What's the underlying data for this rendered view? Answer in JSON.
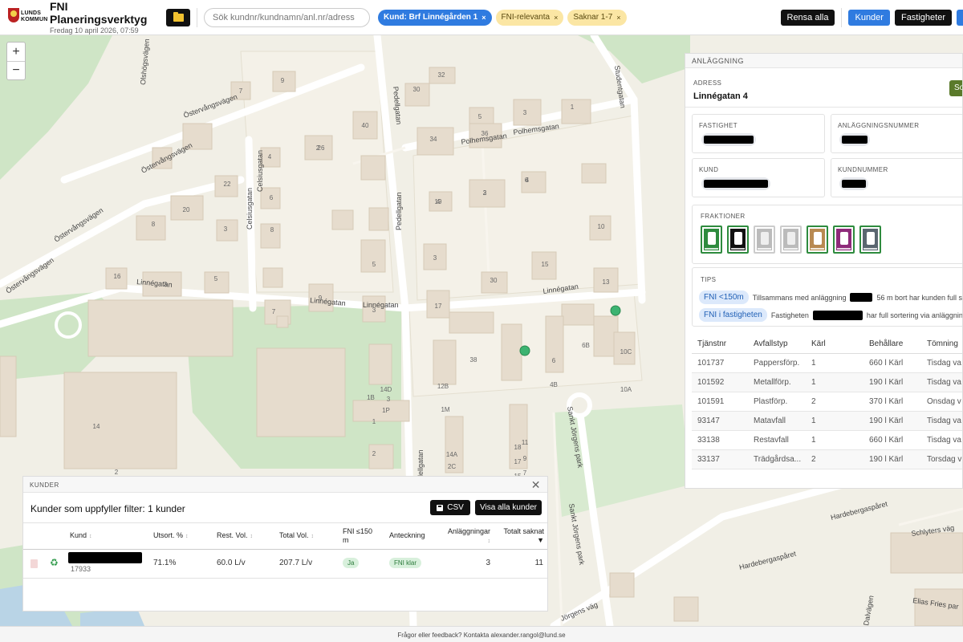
{
  "header": {
    "logo_text": "LUNDS KOMMUN",
    "title": "FNI Planeringsverktyg",
    "date": "Fredag 10 april 2026, 07:59",
    "folder_icon": "folder-icon",
    "search_placeholder": "Sök kundnr/kundnamn/anl.nr/adress",
    "filters": [
      {
        "label": "Kund: Brf Linnégården 1",
        "style": "blue"
      },
      {
        "label": "FNI-relevanta",
        "style": "yellow"
      },
      {
        "label": "Saknar 1-7",
        "style": "yellow"
      }
    ],
    "remove_glyph": "×",
    "clear_all": "Rensa alla",
    "view_customers": "Kunder",
    "view_properties": "Fastigheter"
  },
  "map": {
    "zoom_in": "+",
    "zoom_out": "−",
    "street_labels": [
      "Östervångsvägen",
      "Östervångsvägen",
      "Östervångsvägen",
      "Östervångsvägen",
      "Olshögsvägen",
      "Celsiusgatan",
      "Celsiusgatan",
      "Pedellgatan",
      "Pedellgatan",
      "Polhemsgatan",
      "Polhemsgatan",
      "Studentgatan",
      "Linnégatan",
      "Linnégatan",
      "Linnégatan",
      "Linnégatan",
      "Sankt Jörgens park",
      "Sankt Jörgens park",
      "Hardebergaspåret",
      "Hardebergaspåret",
      "Schlyters väg",
      "Elias Fries par",
      "Pedellgatan",
      "Jörgens väg",
      "Dalvägen"
    ],
    "house_numbers": [
      "7",
      "9",
      "30",
      "32",
      "5",
      "3",
      "1",
      "40",
      "34",
      "36",
      "2",
      "4",
      "26",
      "6",
      "8",
      "3",
      "22",
      "20",
      "8",
      "6",
      "3",
      "4",
      "16",
      "3",
      "5",
      "9",
      "7",
      "5",
      "3",
      "3",
      "30",
      "15",
      "17",
      "13",
      "19",
      "2",
      "4",
      "6",
      "10",
      "38",
      "6B",
      "12B",
      "4B",
      "10A",
      "10C",
      "14D",
      "1P",
      "1M",
      "4D",
      "14A",
      "2C",
      "24",
      "22",
      "20",
      "18",
      "17",
      "15",
      "13",
      "11",
      "9",
      "7",
      "5",
      "3",
      "1",
      "14",
      "2",
      "1B",
      "2",
      "3",
      "1",
      "11",
      "9",
      "7",
      "3",
      "1"
    ],
    "markers": 2,
    "colors": {
      "marker": "#3cb371",
      "park": "#cfe5c6",
      "building": "#e6dccd",
      "road": "#ffffff"
    }
  },
  "facility_panel": {
    "title": "ANLÄGGNING",
    "address_label": "ADRESS",
    "address_value": "Linnégatan 4",
    "address_button": "So",
    "fields": {
      "property_label": "FASTIGHET",
      "facility_number_label": "ANLÄGGNINGSNUMMER",
      "customer_label": "KUND",
      "customer_number_label": "KUNDNUMMER"
    },
    "fractions_label": "FRAKTIONER",
    "fractions": [
      {
        "name": "Matavfall",
        "color": "#2e8b3e",
        "border": "#2e8b3e",
        "active": true
      },
      {
        "name": "Restavfall",
        "color": "#111111",
        "border": "#2e8b3e",
        "active": true
      },
      {
        "name": "Färgat glas",
        "color": "#bbbbbb",
        "border": "#cccccc",
        "active": false
      },
      {
        "name": "Ofärgat glas",
        "color": "#bbbbbb",
        "border": "#cccccc",
        "active": false
      },
      {
        "name": "Pappersförpackningar",
        "color": "#b88a52",
        "border": "#2e8b3e",
        "active": true
      },
      {
        "name": "Plastförpackningar",
        "color": "#8e2a7a",
        "border": "#2e8b3e",
        "active": true
      },
      {
        "name": "Metallförpackningar",
        "color": "#5a6670",
        "border": "#2e8b3e",
        "active": true
      }
    ],
    "tips_label": "TIPS",
    "tips": [
      {
        "chip": "FNI <150m",
        "text_before": "Tillsammans med anläggning",
        "text_after": "56 m bort har kunden full so"
      },
      {
        "chip": "FNI i fastigheten",
        "text_before": "Fastigheten",
        "text_after": "har full sortering via anläggning"
      }
    ],
    "table": {
      "columns": [
        "Tjänstnr",
        "Avfallstyp",
        "Kärl",
        "Behållare",
        "Tömning"
      ],
      "rows": [
        [
          "101737",
          "Pappersförp.",
          "1",
          "660 l Kärl",
          "Tisdag va"
        ],
        [
          "101592",
          "Metallförp.",
          "1",
          "190 l Kärl",
          "Tisdag va"
        ],
        [
          "101591",
          "Plastförp.",
          "2",
          "370 l Kärl",
          "Onsdag v"
        ],
        [
          "93147",
          "Matavfall",
          "1",
          "190 l Kärl",
          "Tisdag va"
        ],
        [
          "33138",
          "Restavfall",
          "1",
          "660 l Kärl",
          "Tisdag va"
        ],
        [
          "33137",
          "Trädgårdsa...",
          "2",
          "190 l Kärl",
          "Torsdag v"
        ]
      ]
    }
  },
  "customers_panel": {
    "title": "KUNDER",
    "close": "✕",
    "heading": "Kunder som uppfyller filter: 1 kunder",
    "csv": "CSV",
    "show_all": "Visa alla kunder",
    "columns": {
      "kund": "Kund",
      "utsort": "Utsort. %",
      "rest": "Rest. Vol.",
      "total": "Total Vol.",
      "fni_line1": "FNI ≤150",
      "fni_line2": "m",
      "note": "Anteckning",
      "facilities": "Anläggningar",
      "missing": "Totalt saknat"
    },
    "sort_glyph": "↕",
    "sort_active": "▼",
    "recycle_glyph": "♻",
    "rows": [
      {
        "customer_number": "17933",
        "utsort": "71.1%",
        "rest": "60.0 L/v",
        "total": "207.7 L/v",
        "fni": "Ja",
        "note": "FNI klar",
        "facilities": "3",
        "missing": "11"
      }
    ]
  },
  "footer": "Frågor eller feedback? Kontakta alexander.rangol@lund.se"
}
